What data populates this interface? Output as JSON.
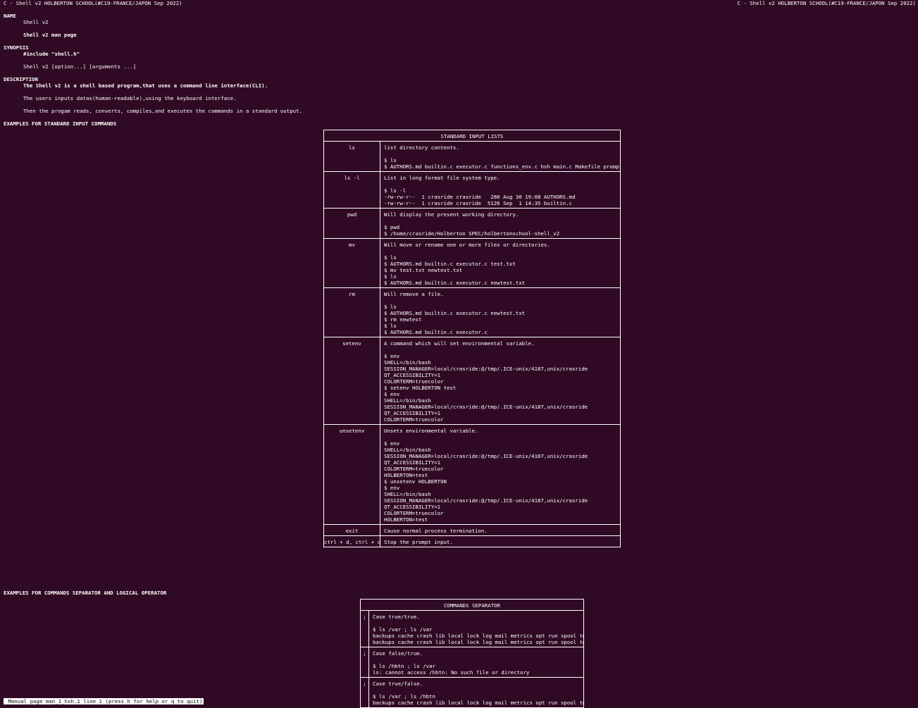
{
  "header": {
    "left": "C - Shell v2 HOLBERTON SCHOOL(#C19-FRANCE/JAPON Sep 2022)",
    "right": "C - Shell v2 HOLBERTON SCHOOL(#C19-FRANCE/JAPON Sep 2022)"
  },
  "name": {
    "heading": "NAME",
    "line1": "Shell v2",
    "line2": "Shell v2 man page"
  },
  "synopsis": {
    "heading": "SYNOPSIS",
    "include": "#include \"shell.h\"",
    "usage": "Shell v2 [option...] [arguments ...]"
  },
  "description": {
    "heading": "DESCRIPTION",
    "line1": "The Shell v2 is a shell based program,that uses a command line interface(CLI).",
    "line2": "The users inputs datas(human-readable),using the keyboard interface.",
    "line3": "Then the progam reads, converts, compiles,and executes the commands in a standard output."
  },
  "examples_standard": {
    "heading": "EXAMPLES FOR STANDARD INPUT COMMANDS",
    "table_title": "STANDARD INPUT LISTS",
    "rows": [
      {
        "cmd": "ls",
        "desc": "list directory contents.\n\n$ ls\n$ AUTHORS.md builtin.c executor.c functions_env.c hsh main.c Makefile prompt.c"
      },
      {
        "cmd": "ls -l",
        "desc": "List in long format file system type.\n\n$ ls -l\n-rw-rw-r--  1 crasride crasride   280 Aug 30 19:08 AUTHORS.md\n-rw-rw-r--  1 crasride crasride  5126 Sep  1 14:35 builtin.c\n"
      },
      {
        "cmd": "pwd",
        "desc": "Will display the present working directory.\n\n$ pwd\n$ /home/crasride/Holberton SPEC/holbertonschool-shell_v2"
      },
      {
        "cmd": "mv",
        "desc": "Will move or rename one or more files or directories.\n\n$ ls\n$ AUTHORS.md builtin.c executor.c test.txt\n$ mv test.txt newtest.txt\n$ ls\n$ AUTHORS.md builtin.c executor.c newtest.txt\n"
      },
      {
        "cmd": "rm",
        "desc": "Will remove a file.\n\n$ ls\n$ AUTHORS.md builtin.c executor.c newtest.txt\n$ rm newtest\n$ ls\n$ AUTHORS.md builtin.c executor.c"
      },
      {
        "cmd": "setenv",
        "desc": "A command which will set environmental variable.\n\n$ env\nSHELL=/bin/bash\nSESSION_MANAGER=local/crasride:@/tmp/.ICE-unix/4187,unix/crasride\nQT_ACCESSIBILITY=1\nCOLORTERM=truecolor\n$ setenv HOLBERTON test\n$ env\nSHELL=/bin/bash\nSESSION_MANAGER=local/crasride:@/tmp/.ICE-unix/4187,unix/crasride\nQT_ACCESSIBILITY=1\nCOLORTERM=truecolor"
      },
      {
        "cmd": "unsetenv",
        "desc": "Unsets environmental variable.\n\n$ env\nSHELL=/bin/bash\nSESSION_MANAGER=local/crasride:@/tmp/.ICE-unix/4187,unix/crasride\nQT_ACCESSIBILITY=1\nCOLORTERM=truecolor\nHOLBERTON=test\n$ unsetenv HOLBERTON\n$ env\nSHELL=/bin/bash\nSESSION_MANAGER=local/crasride:@/tmp/.ICE-unix/4187,unix/crasride\nQT_ACCESSIBILITY=1\nCOLORTERM=truecolor\nHOLBERTON=test"
      },
      {
        "cmd": "exit",
        "desc": "Cause normal process termination."
      },
      {
        "cmd": "ctrl + d, ctrl + c",
        "desc": "Stop the prompt input."
      }
    ]
  },
  "examples_separator": {
    "heading": "EXAMPLES FOR COMMANDS SEPARATOR AND LOGICAL OPERATOR",
    "table_title": "COMMANDS SEPARATOR",
    "rows": [
      {
        "sep": ";",
        "desc": "Case true/true.\n\n$ ls /var ; ls /var\nbackups cache crash lib local lock log mail metrics opt run spool tmp\nbackups cache crash lib local lock log mail metrics opt run spool tmp"
      },
      {
        "sep": ";",
        "desc": "Case false/true.\n\n$ ls /hbtn ; ls /var\nls: cannot access /hbtn: No such file or directory"
      },
      {
        "sep": ";",
        "desc": "Case true/false.\n\n$ ls /var ; ls /hbtn\nbackups cache crash lib local lock log mail metrics opt run spool tmp"
      }
    ]
  },
  "status_bar": " Manual page man_1_hsh.1 line 1 (press h for help or q to quit)"
}
